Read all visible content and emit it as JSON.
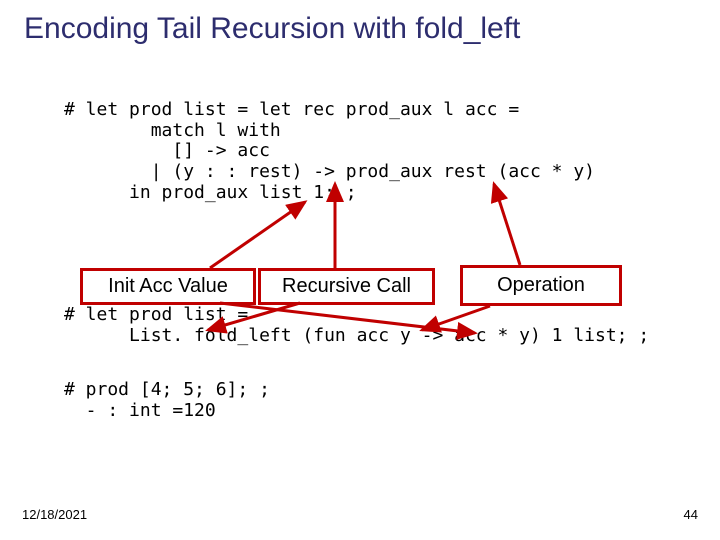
{
  "title": "Encoding Tail Recursion with fold_left",
  "code_block1": "# let prod list = let rec prod_aux l acc =\n        match l with\n          [] -> acc\n        | (y : : rest) -> prod_aux rest (acc * y)\n      in prod_aux list 1; ;",
  "labels": {
    "init": "Init Acc Value",
    "rec": "Recursive Call",
    "op": "Operation"
  },
  "code_block2": "# let prod list =\n      List. fold_left (fun acc y -> acc * y) 1 list; ;",
  "code_block3": "# prod [4; 5; 6]; ;\n  - : int =120",
  "footer": {
    "date": "12/18/2021",
    "page": "44"
  }
}
